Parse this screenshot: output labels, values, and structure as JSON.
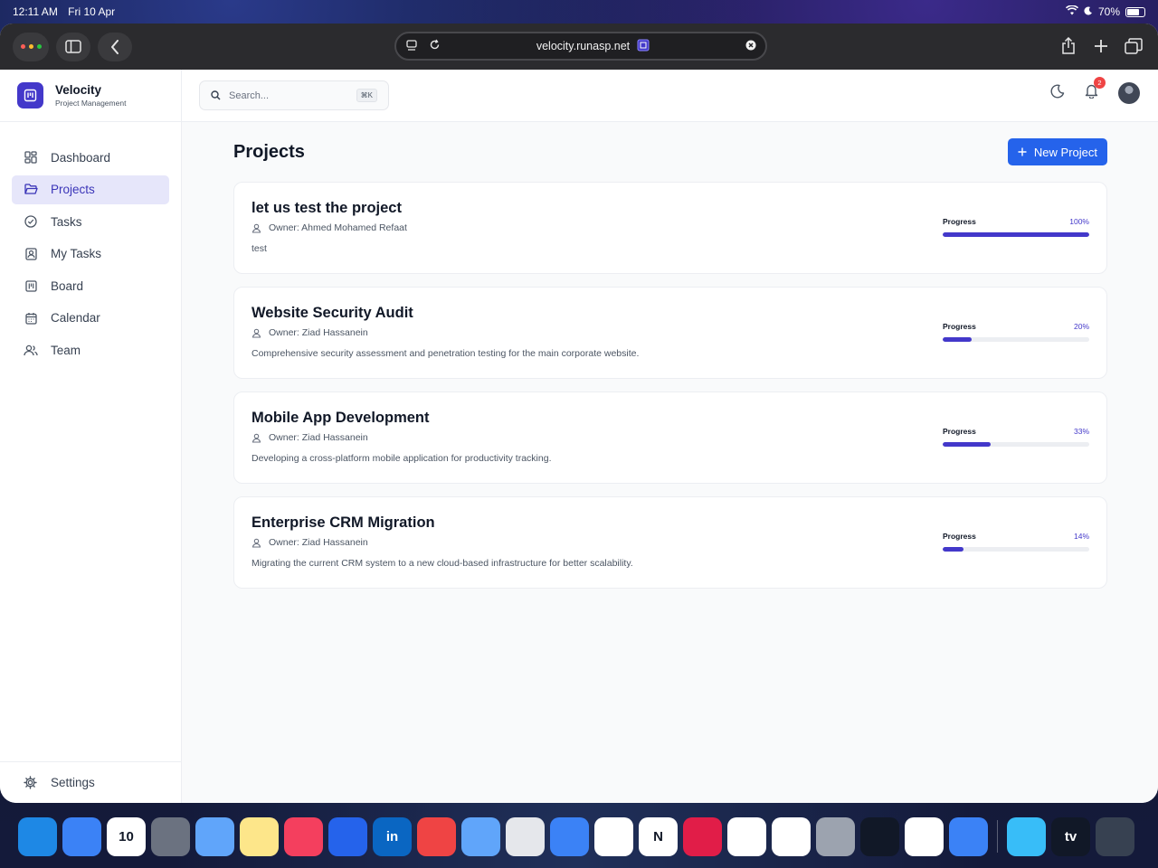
{
  "status_bar": {
    "time": "12:11 AM",
    "date": "Fri 10 Apr",
    "battery": "70%"
  },
  "browser": {
    "url": "velocity.runasp.net"
  },
  "brand": {
    "title": "Velocity",
    "subtitle": "Project Management"
  },
  "search": {
    "placeholder": "Search...",
    "shortcut": "⌘K"
  },
  "notifications": {
    "count": "2"
  },
  "nav": {
    "items": [
      {
        "label": "Dashboard",
        "icon": "grid-icon"
      },
      {
        "label": "Projects",
        "icon": "folder-icon",
        "active": true
      },
      {
        "label": "Tasks",
        "icon": "check-circle-icon"
      },
      {
        "label": "My Tasks",
        "icon": "user-badge-icon"
      },
      {
        "label": "Board",
        "icon": "board-icon"
      },
      {
        "label": "Calendar",
        "icon": "calendar-icon"
      },
      {
        "label": "Team",
        "icon": "users-icon"
      }
    ],
    "settings_label": "Settings"
  },
  "page": {
    "title": "Projects",
    "new_button": "New Project"
  },
  "projects": [
    {
      "title": "let us test the project",
      "owner": "Owner: Ahmed Mohamed Refaat",
      "description": "test",
      "progress_label": "Progress",
      "progress_text": "100%",
      "progress": 100
    },
    {
      "title": "Website Security Audit",
      "owner": "Owner: Ziad Hassanein",
      "description": "Comprehensive security assessment and penetration testing for the main corporate website.",
      "progress_label": "Progress",
      "progress_text": "20%",
      "progress": 20
    },
    {
      "title": "Mobile App Development",
      "owner": "Owner: Ziad Hassanein",
      "description": "Developing a cross-platform mobile application for productivity tracking.",
      "progress_label": "Progress",
      "progress_text": "33%",
      "progress": 33
    },
    {
      "title": "Enterprise CRM Migration",
      "owner": "Owner: Ziad Hassanein",
      "description": "Migrating the current CRM system to a new cloud-based infrastructure for better scalability.",
      "progress_label": "Progress",
      "progress_text": "14%",
      "progress": 14
    }
  ],
  "colors": {
    "accent": "#4338ca",
    "primary_button": "#2563eb",
    "active_nav_bg": "#e6e6fa",
    "badge": "#ef4444"
  },
  "dock": {
    "apps": [
      {
        "name": "safari-icon",
        "bg": "#1e88e5"
      },
      {
        "name": "mail-icon",
        "bg": "#3b82f6"
      },
      {
        "name": "calendar-app-icon",
        "bg": "#ffffff",
        "label": "10"
      },
      {
        "name": "calculator-icon",
        "bg": "#6b7280"
      },
      {
        "name": "database-icon",
        "bg": "#60a5fa"
      },
      {
        "name": "notes-icon",
        "bg": "#fde68a"
      },
      {
        "name": "music-icon",
        "bg": "#f43f5e"
      },
      {
        "name": "app-store-icon",
        "bg": "#2563eb"
      },
      {
        "name": "linkedin-icon",
        "bg": "#0a66c2",
        "label": "in"
      },
      {
        "name": "youtube-icon",
        "bg": "#ef4444"
      },
      {
        "name": "translate-icon",
        "bg": "#60a5fa"
      },
      {
        "name": "freeform-icon",
        "bg": "#e5e7eb"
      },
      {
        "name": "google-translate-icon",
        "bg": "#3b82f6"
      },
      {
        "name": "chatgpt-icon",
        "bg": "#ffffff"
      },
      {
        "name": "notion-icon",
        "bg": "#ffffff",
        "label": "N"
      },
      {
        "name": "pinterest-icon",
        "bg": "#e11d48"
      },
      {
        "name": "slack-icon",
        "bg": "#ffffff"
      },
      {
        "name": "figma-icon",
        "bg": "#ffffff"
      },
      {
        "name": "system-settings-icon",
        "bg": "#9ca3af"
      },
      {
        "name": "camera-icon",
        "bg": "#111827"
      },
      {
        "name": "photos-icon",
        "bg": "#ffffff"
      },
      {
        "name": "files-icon",
        "bg": "#3b82f6"
      },
      {
        "name": "telegram-icon",
        "bg": "#38bdf8"
      },
      {
        "name": "apple-tv-icon",
        "bg": "#111827",
        "label": "tv"
      },
      {
        "name": "app-library-icon",
        "bg": "#374151"
      }
    ]
  }
}
